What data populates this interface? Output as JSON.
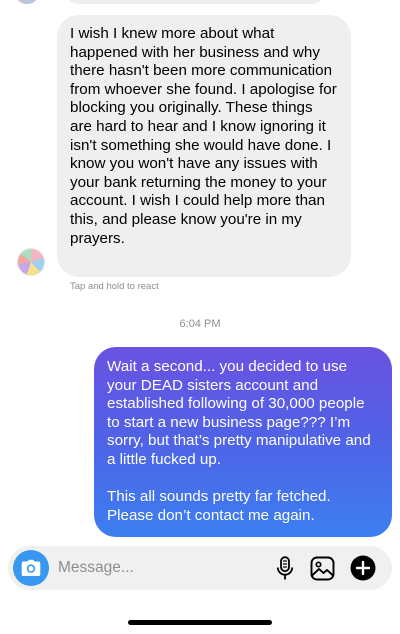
{
  "thread": {
    "incoming_message": "I wish I knew more about what happened with her business and why there hasn't been more communication from whoever she found. I apologise for blocking you originally. These things are hard to hear and I know ignoring it isn't something she would have done. I know you won't have any issues with your bank returning the money to your account. I wish I could help more than this, and please know you're in my prayers.",
    "react_hint": "Tap and hold to react",
    "timestamp": "6:04 PM",
    "outgoing_message": {
      "paragraph_1": "Wait a second... you decided to use your DEAD sisters account and established following of 30,000 people to start a new business page??? I’m sorry, but that’s pretty manipulative and a little fucked up.",
      "paragraph_2": "This all sounds pretty far fetched. Please don’t contact me again."
    }
  },
  "composer": {
    "placeholder": "Message...",
    "value": "",
    "icons": [
      "camera-icon",
      "microphone-icon",
      "gallery-icon",
      "plus-circle-icon"
    ]
  },
  "colors": {
    "incoming_bubble": "#efefef",
    "outgoing_gradient_top": "#6a52e2",
    "outgoing_gradient_bottom": "#3b7ff0",
    "camera_button": "#3897f0",
    "muted_text": "#8e8e8e"
  }
}
